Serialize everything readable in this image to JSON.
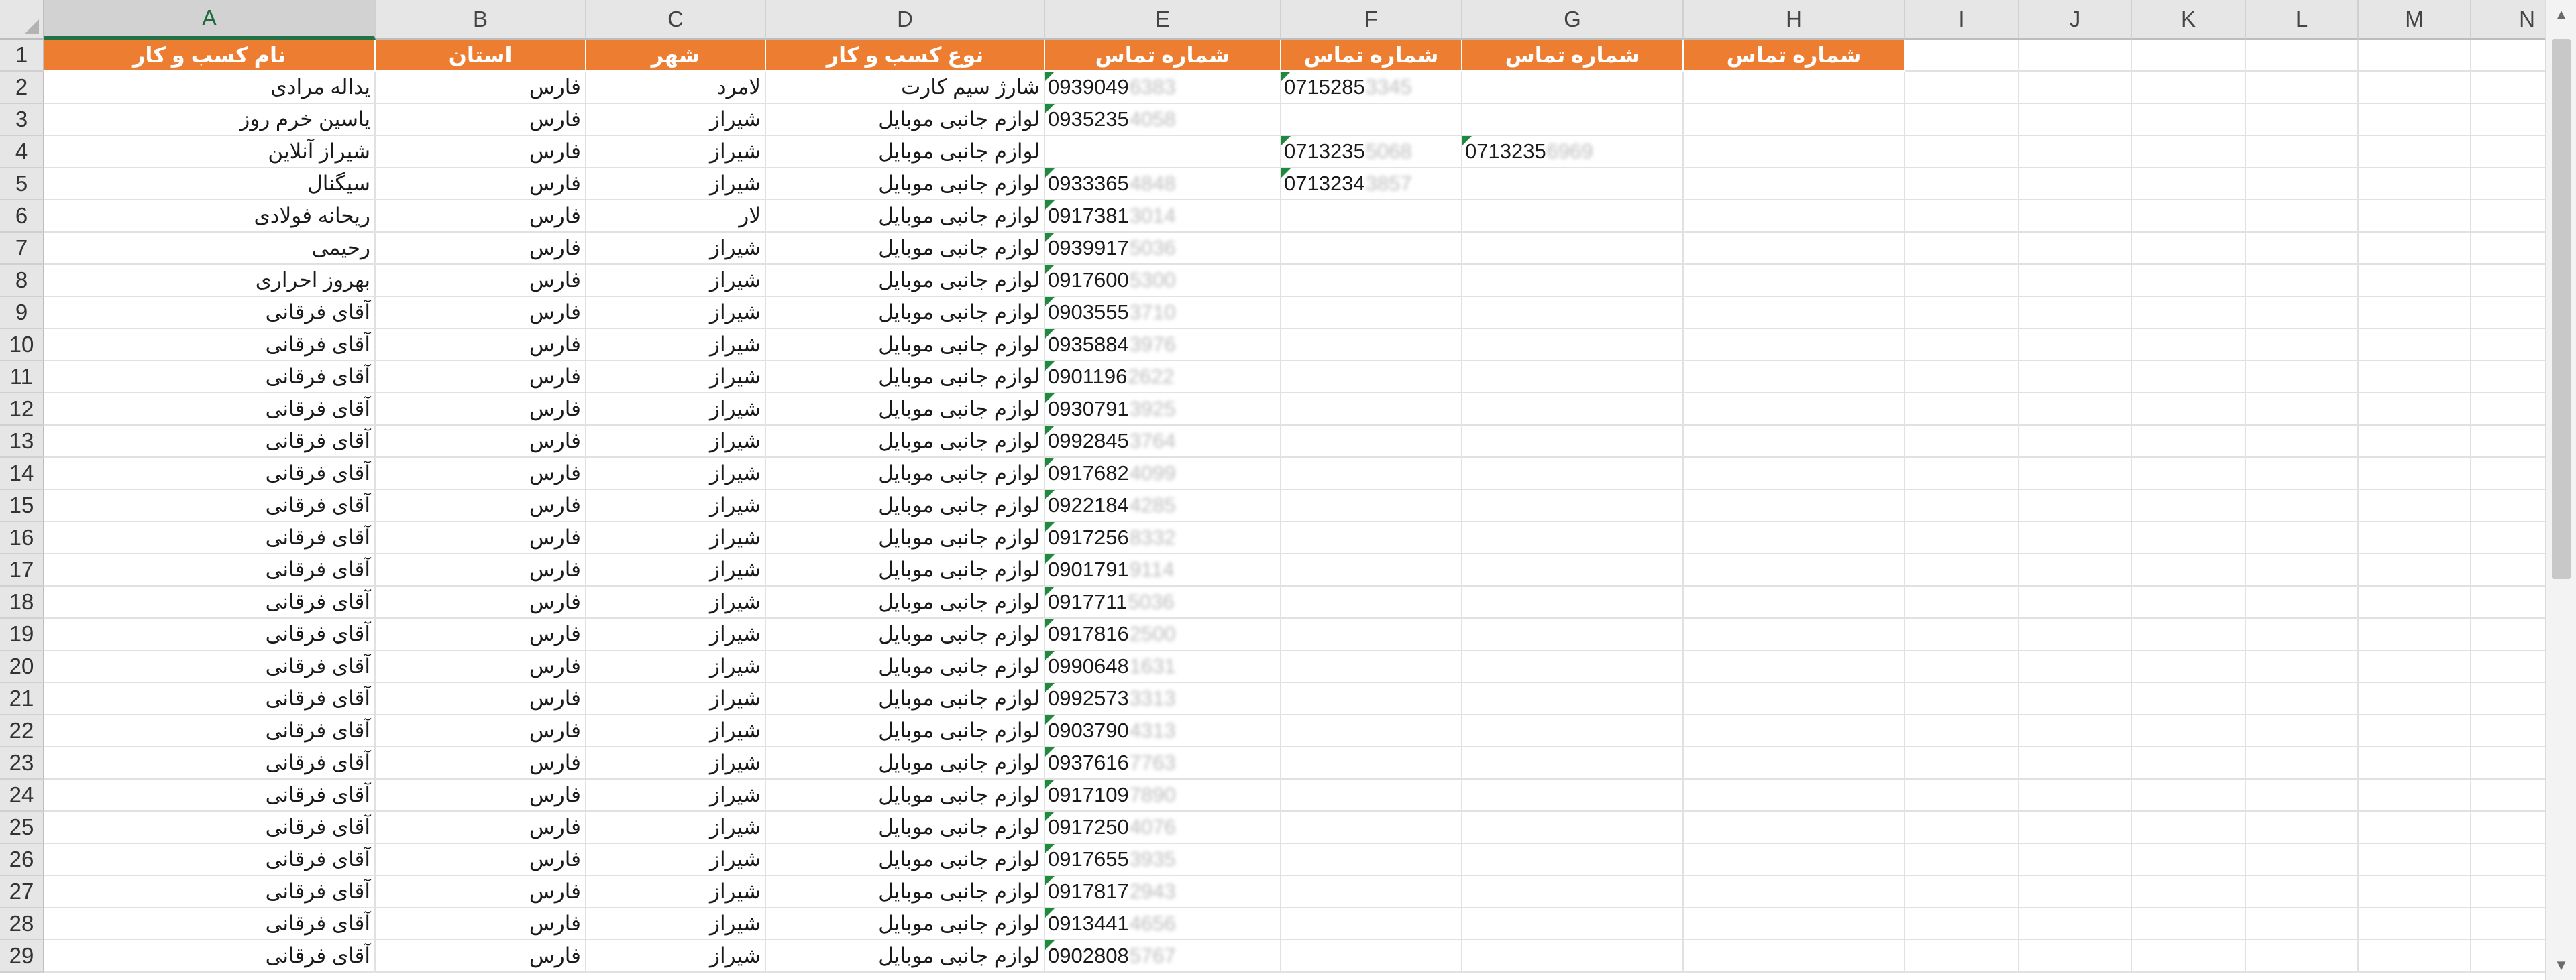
{
  "columns": [
    "A",
    "B",
    "C",
    "D",
    "E",
    "F",
    "G",
    "H",
    "I",
    "J",
    "K",
    "L",
    "M",
    "N"
  ],
  "selected_column": "A",
  "header_row": {
    "row_number": "1",
    "cells": [
      "نام کسب و کار",
      "استان",
      "شهر",
      "نوع کسب و کار",
      "شماره تماس",
      "شماره تماس",
      "شماره تماس",
      "شماره تماس"
    ]
  },
  "rows": [
    {
      "n": "2",
      "name": "یداله مرادی",
      "state": "فارس",
      "city": "لامرد",
      "type": "شارژ سیم کارت",
      "e": "0939049",
      "eb": "6383",
      "f": "0715285",
      "fb": "3345",
      "g": "",
      "gb": ""
    },
    {
      "n": "3",
      "name": "یاسین خرم روز",
      "state": "فارس",
      "city": "شیراز",
      "type": "لوازم جانبی موبایل",
      "e": "0935235",
      "eb": "4058",
      "f": "",
      "fb": "",
      "g": "",
      "gb": ""
    },
    {
      "n": "4",
      "name": "شیراز آنلاین",
      "state": "فارس",
      "city": "شیراز",
      "type": "لوازم جانبی موبایل",
      "e": "",
      "eb": "",
      "f": "0713235",
      "fb": "5068",
      "g": "0713235",
      "gb": "6969"
    },
    {
      "n": "5",
      "name": "سیگنال",
      "state": "فارس",
      "city": "شیراز",
      "type": "لوازم جانبی موبایل",
      "e": "0933365",
      "eb": "4848",
      "f": "0713234",
      "fb": "3857",
      "g": "",
      "gb": ""
    },
    {
      "n": "6",
      "name": "ریحانه فولادی",
      "state": "فارس",
      "city": "لار",
      "type": "لوازم جانبی موبایل",
      "e": "0917381",
      "eb": "3014",
      "f": "",
      "fb": "",
      "g": "",
      "gb": ""
    },
    {
      "n": "7",
      "name": "رحیمی",
      "state": "فارس",
      "city": "شیراز",
      "type": "لوازم جانبی موبایل",
      "e": "0939917",
      "eb": "5036",
      "f": "",
      "fb": "",
      "g": "",
      "gb": ""
    },
    {
      "n": "8",
      "name": "بهروز احراری",
      "state": "فارس",
      "city": "شیراز",
      "type": "لوازم جانبی موبایل",
      "e": "0917600",
      "eb": "5300",
      "f": "",
      "fb": "",
      "g": "",
      "gb": ""
    },
    {
      "n": "9",
      "name": "آقای فرقانی",
      "state": "فارس",
      "city": "شیراز",
      "type": "لوازم جانبی موبایل",
      "e": "0903555",
      "eb": "3710",
      "f": "",
      "fb": "",
      "g": "",
      "gb": ""
    },
    {
      "n": "10",
      "name": "آقای فرقانی",
      "state": "فارس",
      "city": "شیراز",
      "type": "لوازم جانبی موبایل",
      "e": "0935884",
      "eb": "3976",
      "f": "",
      "fb": "",
      "g": "",
      "gb": ""
    },
    {
      "n": "11",
      "name": "آقای فرقانی",
      "state": "فارس",
      "city": "شیراز",
      "type": "لوازم جانبی موبایل",
      "e": "0901196",
      "eb": "2622",
      "f": "",
      "fb": "",
      "g": "",
      "gb": ""
    },
    {
      "n": "12",
      "name": "آقای فرقانی",
      "state": "فارس",
      "city": "شیراز",
      "type": "لوازم جانبی موبایل",
      "e": "0930791",
      "eb": "3925",
      "f": "",
      "fb": "",
      "g": "",
      "gb": ""
    },
    {
      "n": "13",
      "name": "آقای فرقانی",
      "state": "فارس",
      "city": "شیراز",
      "type": "لوازم جانبی موبایل",
      "e": "0992845",
      "eb": "3764",
      "f": "",
      "fb": "",
      "g": "",
      "gb": ""
    },
    {
      "n": "14",
      "name": "آقای فرقانی",
      "state": "فارس",
      "city": "شیراز",
      "type": "لوازم جانبی موبایل",
      "e": "0917682",
      "eb": "4099",
      "f": "",
      "fb": "",
      "g": "",
      "gb": ""
    },
    {
      "n": "15",
      "name": "آقای فرقانی",
      "state": "فارس",
      "city": "شیراز",
      "type": "لوازم جانبی موبایل",
      "e": "0922184",
      "eb": "4285",
      "f": "",
      "fb": "",
      "g": "",
      "gb": ""
    },
    {
      "n": "16",
      "name": "آقای فرقانی",
      "state": "فارس",
      "city": "شیراز",
      "type": "لوازم جانبی موبایل",
      "e": "0917256",
      "eb": "8332",
      "f": "",
      "fb": "",
      "g": "",
      "gb": ""
    },
    {
      "n": "17",
      "name": "آقای فرقانی",
      "state": "فارس",
      "city": "شیراز",
      "type": "لوازم جانبی موبایل",
      "e": "0901791",
      "eb": "9114",
      "f": "",
      "fb": "",
      "g": "",
      "gb": ""
    },
    {
      "n": "18",
      "name": "آقای فرقانی",
      "state": "فارس",
      "city": "شیراز",
      "type": "لوازم جانبی موبایل",
      "e": "0917711",
      "eb": "5036",
      "f": "",
      "fb": "",
      "g": "",
      "gb": ""
    },
    {
      "n": "19",
      "name": "آقای فرقانی",
      "state": "فارس",
      "city": "شیراز",
      "type": "لوازم جانبی موبایل",
      "e": "0917816",
      "eb": "2500",
      "f": "",
      "fb": "",
      "g": "",
      "gb": ""
    },
    {
      "n": "20",
      "name": "آقای فرقانی",
      "state": "فارس",
      "city": "شیراز",
      "type": "لوازم جانبی موبایل",
      "e": "0990648",
      "eb": "1631",
      "f": "",
      "fb": "",
      "g": "",
      "gb": ""
    },
    {
      "n": "21",
      "name": "آقای فرقانی",
      "state": "فارس",
      "city": "شیراز",
      "type": "لوازم جانبی موبایل",
      "e": "0992573",
      "eb": "3313",
      "f": "",
      "fb": "",
      "g": "",
      "gb": ""
    },
    {
      "n": "22",
      "name": "آقای فرقانی",
      "state": "فارس",
      "city": "شیراز",
      "type": "لوازم جانبی موبایل",
      "e": "0903790",
      "eb": "4313",
      "f": "",
      "fb": "",
      "g": "",
      "gb": ""
    },
    {
      "n": "23",
      "name": "آقای فرقانی",
      "state": "فارس",
      "city": "شیراز",
      "type": "لوازم جانبی موبایل",
      "e": "0937616",
      "eb": "7763",
      "f": "",
      "fb": "",
      "g": "",
      "gb": ""
    },
    {
      "n": "24",
      "name": "آقای فرقانی",
      "state": "فارس",
      "city": "شیراز",
      "type": "لوازم جانبی موبایل",
      "e": "0917109",
      "eb": "7890",
      "f": "",
      "fb": "",
      "g": "",
      "gb": ""
    },
    {
      "n": "25",
      "name": "آقای فرقانی",
      "state": "فارس",
      "city": "شیراز",
      "type": "لوازم جانبی موبایل",
      "e": "0917250",
      "eb": "4076",
      "f": "",
      "fb": "",
      "g": "",
      "gb": ""
    },
    {
      "n": "26",
      "name": "آقای فرقانی",
      "state": "فارس",
      "city": "شیراز",
      "type": "لوازم جانبی موبایل",
      "e": "0917655",
      "eb": "3935",
      "f": "",
      "fb": "",
      "g": "",
      "gb": ""
    },
    {
      "n": "27",
      "name": "آقای فرقانی",
      "state": "فارس",
      "city": "شیراز",
      "type": "لوازم جانبی موبایل",
      "e": "0917817",
      "eb": "2943",
      "f": "",
      "fb": "",
      "g": "",
      "gb": ""
    },
    {
      "n": "28",
      "name": "آقای فرقانی",
      "state": "فارس",
      "city": "شیراز",
      "type": "لوازم جانبی موبایل",
      "e": "0913441",
      "eb": "4656",
      "f": "",
      "fb": "",
      "g": "",
      "gb": ""
    },
    {
      "n": "29",
      "name": "آقای فرقانی",
      "state": "فارس",
      "city": "شیراز",
      "type": "لوازم جانبی موبایل",
      "e": "0902808",
      "eb": "5767",
      "f": "",
      "fb": "",
      "g": "",
      "gb": ""
    }
  ],
  "colors": {
    "header_fill": "#ed7d31",
    "header_text": "#ffffff",
    "selected_col": "#217346",
    "error_triangle": "#1f8a3e"
  },
  "icons": {
    "scroll_up": "chevron-up-icon",
    "scroll_down": "chevron-down-icon"
  }
}
